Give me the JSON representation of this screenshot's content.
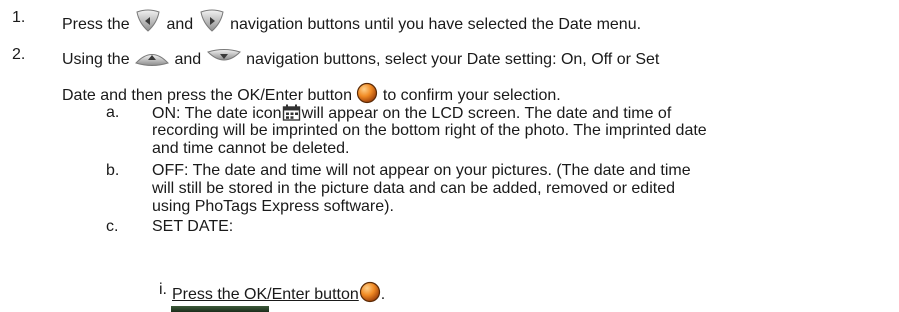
{
  "step1": {
    "number": "1.",
    "part1": "Press the",
    "part2": "and",
    "part3": "navigation buttons until you have selected the Date menu.",
    "icons": [
      "nav-left-button-icon",
      "nav-right-button-icon"
    ]
  },
  "step2": {
    "number": "2.",
    "part1": "Using the",
    "part2": "and",
    "part3": "navigation buttons, select your Date setting: On, Off or Set",
    "cont1": "Date and then press the OK/Enter button",
    "cont2": "to confirm your selection.",
    "icons": [
      "nav-up-button-icon",
      "nav-down-button-icon",
      "ok-enter-button-icon"
    ]
  },
  "sub_a": {
    "letter": "a.",
    "l1a": "ON: The date icon",
    "l1b": "will appear on the LCD screen. The date and time of",
    "l2": "recording will be imprinted on the bottom right of the photo. The imprinted date",
    "l3": "and time cannot be deleted.",
    "icon": "date-icon"
  },
  "sub_b": {
    "letter": "b.",
    "l1": "OFF: The date and time will not appear on your pictures. (The date and time",
    "l2": "will still be stored in the picture data and can be added, removed or edited",
    "l3": "using PhoTags Express software)."
  },
  "sub_c": {
    "letter": "c.",
    "l1": "SET DATE:"
  },
  "sub_i": {
    "numeral": "i.",
    "text": "Press the OK/Enter button",
    "end": ".",
    "icon": "ok-enter-button-icon"
  },
  "colors": {
    "text": "#1a1a1a",
    "button_gray": "#a7a7a7",
    "ok_orange": "#e8781e"
  }
}
